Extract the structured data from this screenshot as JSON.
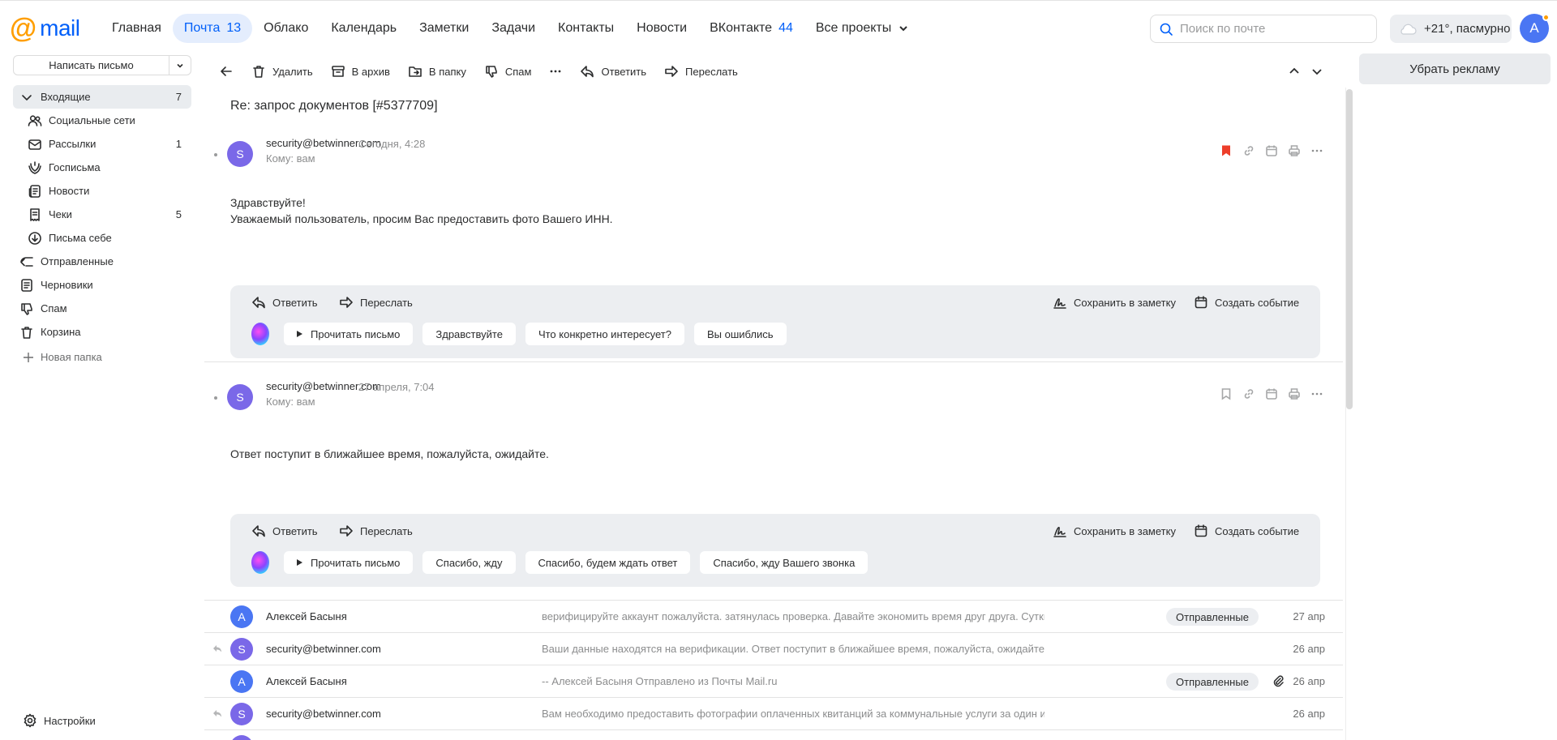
{
  "logo": {
    "at": "@",
    "wordmark": "mail"
  },
  "nav": [
    {
      "label": "Главная",
      "count": ""
    },
    {
      "label": "Почта",
      "count": "13"
    },
    {
      "label": "Облако",
      "count": ""
    },
    {
      "label": "Календарь",
      "count": ""
    },
    {
      "label": "Заметки",
      "count": ""
    },
    {
      "label": "Задачи",
      "count": ""
    },
    {
      "label": "Контакты",
      "count": ""
    },
    {
      "label": "Новости",
      "count": ""
    },
    {
      "label": "ВКонтакте",
      "count": "44"
    },
    {
      "label": "Все проекты",
      "count": ""
    }
  ],
  "search": {
    "placeholder": "Поиск по почте"
  },
  "weather": {
    "text": "+21°, пасмурно"
  },
  "user": {
    "initial": "А"
  },
  "sidebar": {
    "compose_label": "Написать письмо",
    "folders": [
      {
        "label": "Входящие",
        "count": "7",
        "icon": "chevron-down-icon"
      },
      {
        "label": "Социальные сети",
        "count": "",
        "icon": "people-icon"
      },
      {
        "label": "Рассылки",
        "count": "1",
        "icon": "mail-icon"
      },
      {
        "label": "Госписьма",
        "count": "",
        "icon": "crest-icon"
      },
      {
        "label": "Новости",
        "count": "",
        "icon": "newspaper-icon"
      },
      {
        "label": "Чеки",
        "count": "5",
        "icon": "receipt-icon"
      },
      {
        "label": "Письма себе",
        "count": "",
        "icon": "download-icon"
      },
      {
        "label": "Отправленные",
        "count": "",
        "icon": "send-icon"
      },
      {
        "label": "Черновики",
        "count": "",
        "icon": "draft-icon"
      },
      {
        "label": "Спам",
        "count": "",
        "icon": "thumb-down-icon"
      },
      {
        "label": "Корзина",
        "count": "",
        "icon": "trash-icon"
      }
    ],
    "new_folder": "Новая папка",
    "settings": "Настройки"
  },
  "toolbar": {
    "delete": "Удалить",
    "archive": "В архив",
    "to_folder": "В папку",
    "spam": "Спам",
    "reply": "Ответить",
    "forward": "Переслать"
  },
  "subject": "Re: запрос документов [#5377709]",
  "messages": [
    {
      "initial": "S",
      "from": "security@betwinner.com",
      "date": "Сегодня, 4:28",
      "to": "Кому: вам",
      "body": [
        "Здравствуйте!",
        "Уважаемый пользователь, просим Вас предоставить фото Вашего ИНН."
      ],
      "reply": "Ответить",
      "forward": "Переслать",
      "save_note": "Сохранить в заметку",
      "create_event": "Создать событие",
      "read_aloud": "Прочитать письмо",
      "quick_replies": [
        "Здравствуйте",
        "Что конкретно интересует?",
        "Вы ошиблись"
      ],
      "bookmark_color": "#ed3e2a"
    },
    {
      "initial": "S",
      "from": "security@betwinner.com",
      "date": "27 апреля, 7:04",
      "to": "Кому: вам",
      "body": [
        "Ответ поступит в ближайшее время, пожалуйста, ожидайте."
      ],
      "reply": "Ответить",
      "forward": "Переслать",
      "save_note": "Сохранить в заметку",
      "create_event": "Создать событие",
      "read_aloud": "Прочитать письмо",
      "quick_replies": [
        "Спасибо, жду",
        "Спасибо, будем ждать ответ",
        "Спасибо, жду Вашего звонка"
      ]
    }
  ],
  "thread": [
    {
      "initial": "А",
      "name": "Алексей Басыня",
      "snippet": "верифицируйте аккаунт пожалуйста. затянулась проверка. Давайте экономить время друг друга. Сутки еще",
      "tag": "Отправленные",
      "date": "27 апр",
      "replied": false,
      "clip": false
    },
    {
      "initial": "S",
      "name": "security@betwinner.com",
      "snippet": "Ваши данные находятся на верификации. Ответ поступит в ближайшее время, пожалуйста, ожидайте.",
      "tag": "",
      "date": "26 апр",
      "replied": true,
      "clip": false
    },
    {
      "initial": "А",
      "name": "Алексей Басыня",
      "snippet": "-- Алексей Басыня Отправлено из Почты Mail.ru",
      "tag": "Отправленные",
      "date": "26 апр",
      "replied": false,
      "clip": true
    },
    {
      "initial": "S",
      "name": "security@betwinner.com",
      "snippet": "Вам необходимо предоставить фотографии оплаченных квитанций за коммунальные услуги за один из послед",
      "tag": "",
      "date": "26 апр",
      "replied": true,
      "clip": false
    }
  ],
  "ad": {
    "remove_label": "Убрать рекламу"
  }
}
